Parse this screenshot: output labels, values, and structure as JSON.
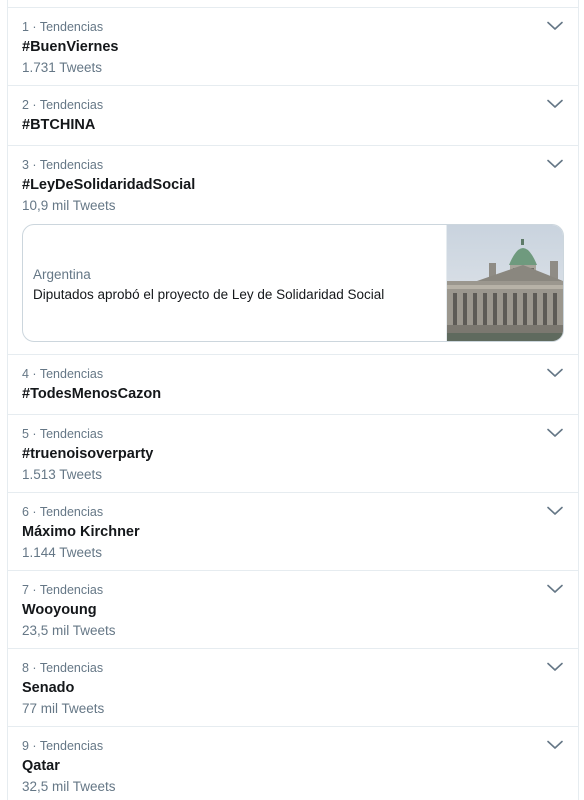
{
  "trends": [
    {
      "meta": "1 · Tendencias",
      "name": "#BuenViernes",
      "count": "1.731 Tweets"
    },
    {
      "meta": "2 · Tendencias",
      "name": "#BTCHINA"
    },
    {
      "meta": "3 · Tendencias",
      "name": "#LeyDeSolidaridadSocial",
      "count": "10,9 mil Tweets",
      "card": {
        "category": "Argentina",
        "title": "Diputados aprobó el proyecto de Ley de Solidaridad Social"
      }
    },
    {
      "meta": "4 · Tendencias",
      "name": "#TodesMenosCazon"
    },
    {
      "meta": "5 · Tendencias",
      "name": "#truenoisoverparty",
      "count": "1.513 Tweets"
    },
    {
      "meta": "6 · Tendencias",
      "name": "Máximo Kirchner",
      "count": "1.144 Tweets"
    },
    {
      "meta": "7 · Tendencias",
      "name": "Wooyoung",
      "count": "23,5 mil Tweets"
    },
    {
      "meta": "8 · Tendencias",
      "name": "Senado",
      "count": "77 mil Tweets"
    },
    {
      "meta": "9 · Tendencias",
      "name": "Qatar",
      "count": "32,5 mil Tweets"
    }
  ],
  "icons": {
    "menu": "chevron-down-icon",
    "card_image": "congress-building-image"
  },
  "colors": {
    "secondary_text": "#657786",
    "primary_text": "#14171a",
    "border": "#e6ecf0",
    "chevron": "#657786"
  }
}
